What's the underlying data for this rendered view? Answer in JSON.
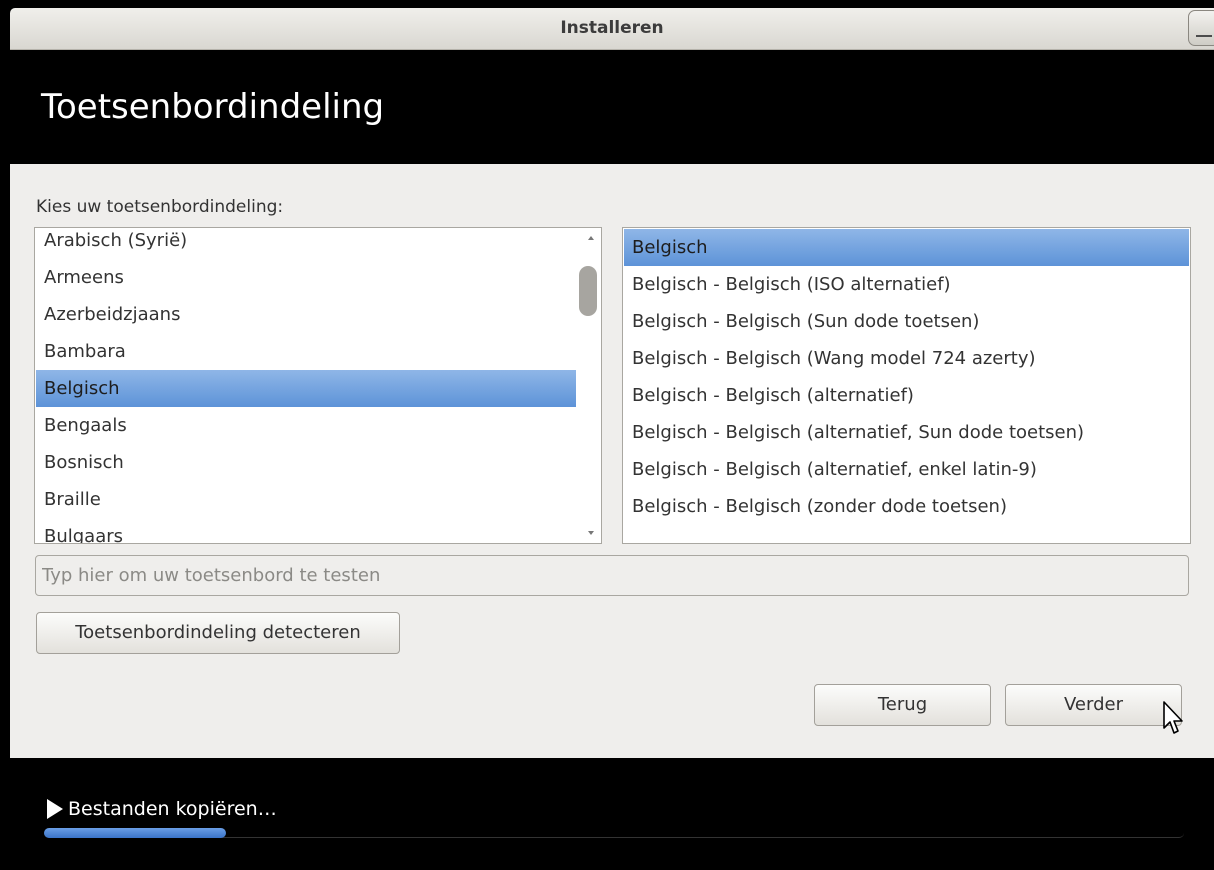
{
  "window": {
    "title": "Installeren"
  },
  "header": {
    "heading": "Toetsenbordindeling"
  },
  "main": {
    "prompt": "Kies uw toetsenbordindeling:",
    "layouts": [
      "Arabisch (Syrië)",
      "Armeens",
      "Azerbeidzjaans",
      "Bambara",
      "Belgisch",
      "Bengaals",
      "Bosnisch",
      "Braille",
      "Bulgaars"
    ],
    "selected_layout": "Belgisch",
    "variants": [
      "Belgisch",
      "Belgisch - Belgisch (ISO alternatief)",
      "Belgisch - Belgisch (Sun dode toetsen)",
      "Belgisch - Belgisch (Wang model 724 azerty)",
      "Belgisch - Belgisch (alternatief)",
      "Belgisch - Belgisch (alternatief, Sun dode toetsen)",
      "Belgisch - Belgisch (alternatief, enkel latin-9)",
      "Belgisch - Belgisch (zonder dode toetsen)"
    ],
    "selected_variant": "Belgisch",
    "test_input": {
      "value": "",
      "placeholder": "Typ hier om uw toetsenbord te testen"
    },
    "detect_button": "Toetsenbordindeling detecteren",
    "back_button": "Terug",
    "next_button": "Verder"
  },
  "footer": {
    "status": "Bestanden kopiëren…",
    "progress": 0.16
  },
  "colors": {
    "selection": "#5d93d8",
    "progress_fill": "#3a74c9",
    "header_bg": "#000000",
    "content_bg": "#efeeec"
  }
}
